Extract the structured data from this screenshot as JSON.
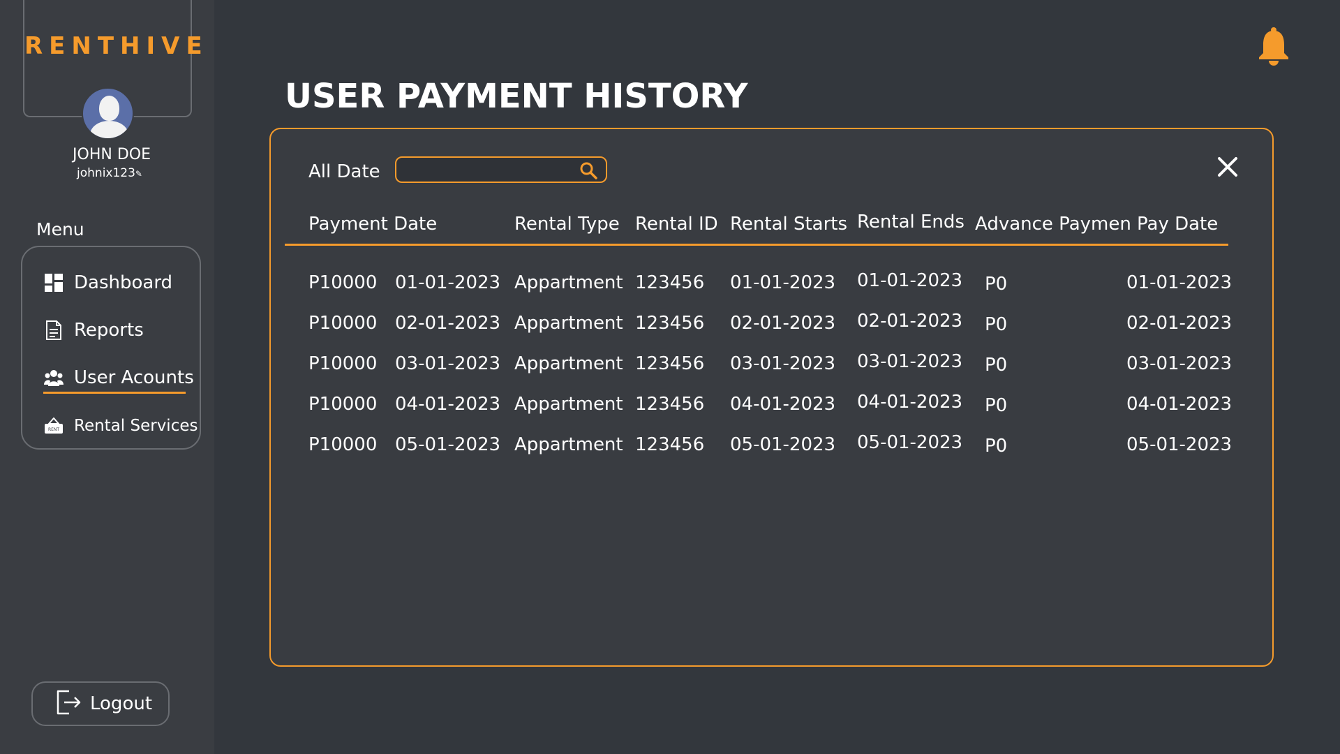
{
  "brand": "RENTHIVE",
  "user": {
    "name": "JOHN DOE",
    "handle": "johnix123"
  },
  "menu": {
    "title": "Menu",
    "items": [
      {
        "label": "Dashboard",
        "icon": "dashboard-icon"
      },
      {
        "label": "Reports",
        "icon": "report-document-icon"
      },
      {
        "label": "User Acounts",
        "icon": "users-group-icon",
        "active": true
      },
      {
        "label": "Rental Services",
        "icon": "rent-sign-icon"
      }
    ]
  },
  "logout": {
    "label": "Logout",
    "icon": "logout-icon"
  },
  "header": {
    "notification_icon": "bell-icon"
  },
  "page": {
    "title": "USER PAYMENT HISTORY"
  },
  "filter": {
    "label": "All Date",
    "search_value": "",
    "search_placeholder": ""
  },
  "table": {
    "columns": [
      "Payment Date",
      "Rental Type",
      "Rental ID",
      "Rental Starts",
      "Rental Ends",
      "Advance Paymen",
      "Pay Date"
    ],
    "rows": [
      [
        "P10000",
        "01-01-2023",
        "Appartment",
        "123456",
        "01-01-2023",
        "01-01-2023",
        "P0",
        "01-01-2023"
      ],
      [
        "P10000",
        "02-01-2023",
        "Appartment",
        "123456",
        "02-01-2023",
        "02-01-2023",
        "P0",
        "02-01-2023"
      ],
      [
        "P10000",
        "03-01-2023",
        "Appartment",
        "123456",
        "03-01-2023",
        "03-01-2023",
        "P0",
        "03-01-2023"
      ],
      [
        "P10000",
        "04-01-2023",
        "Appartment",
        "123456",
        "04-01-2023",
        "04-01-2023",
        "P0",
        "04-01-2023"
      ],
      [
        "P10000",
        "05-01-2023",
        "Appartment",
        "123456",
        "05-01-2023",
        "05-01-2023",
        "P0",
        "05-01-2023"
      ]
    ]
  },
  "colors": {
    "accent": "#f59b2c",
    "background": "#33373d",
    "sidebar": "#3a3d42",
    "text": "#ffffff"
  }
}
